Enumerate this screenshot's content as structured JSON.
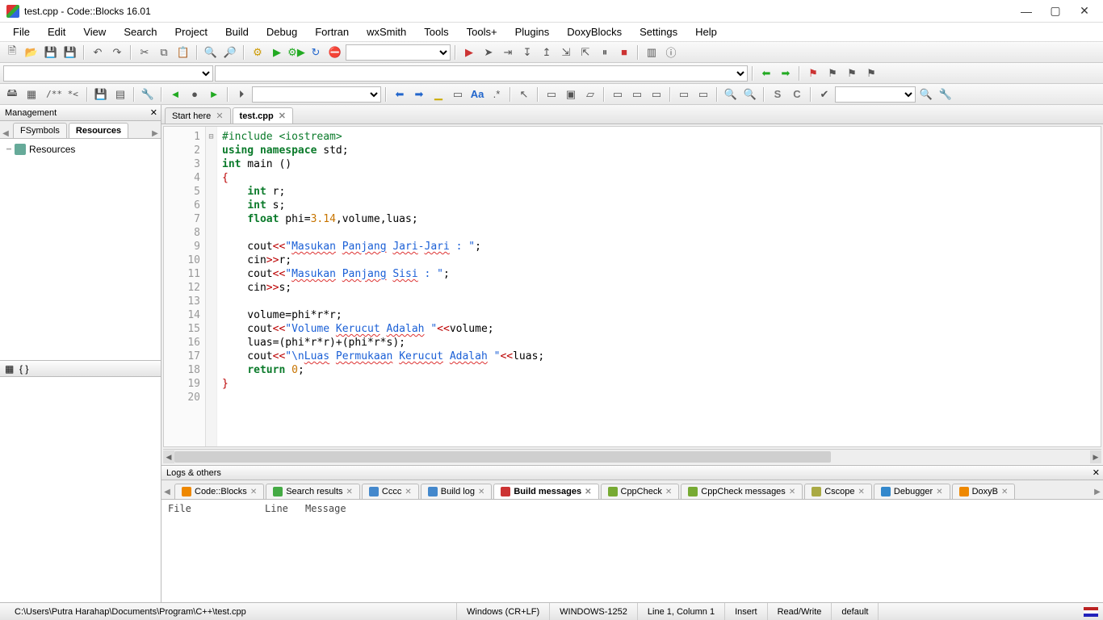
{
  "title": "test.cpp - Code::Blocks 16.01",
  "menu": [
    "File",
    "Edit",
    "View",
    "Search",
    "Project",
    "Build",
    "Debug",
    "Fortran",
    "wxSmith",
    "Tools",
    "Tools+",
    "Plugins",
    "DoxyBlocks",
    "Settings",
    "Help"
  ],
  "management": {
    "title": "Management",
    "tabs": [
      "FSymbols",
      "Resources"
    ],
    "active_tab": "Resources",
    "tree_root": "Resources",
    "lower_label": "{ }"
  },
  "editor_tabs": [
    {
      "label": "Start here",
      "active": false
    },
    {
      "label": "test.cpp",
      "active": true
    }
  ],
  "code_lines": [
    {
      "n": 1,
      "html": "<span class='pp'>#include &lt;iostream&gt;</span>"
    },
    {
      "n": 2,
      "html": "<span class='kw'>using</span> <span class='kw'>namespace</span> std;"
    },
    {
      "n": 3,
      "html": "<span class='kw'>int</span> main ()"
    },
    {
      "n": 4,
      "html": "<span class='brace'>{</span>",
      "fold": "⊟"
    },
    {
      "n": 5,
      "html": "    <span class='kw'>int</span> r;"
    },
    {
      "n": 6,
      "html": "    <span class='kw'>int</span> s;"
    },
    {
      "n": 7,
      "html": "    <span class='kw'>float</span> phi=<span class='num'>3.14</span>,volume,luas;"
    },
    {
      "n": 8,
      "html": ""
    },
    {
      "n": 9,
      "html": "    cout<span class='op'>&lt;&lt;</span><span class='str'>\"<span class='spell'>Masukan</span> <span class='spell'>Panjang</span> <span class='spell'>Jari</span>-<span class='spell'>Jari</span> : \"</span>;"
    },
    {
      "n": 10,
      "html": "    cin<span class='op'>&gt;&gt;</span>r;"
    },
    {
      "n": 11,
      "html": "    cout<span class='op'>&lt;&lt;</span><span class='str'>\"<span class='spell'>Masukan</span> <span class='spell'>Panjang</span> <span class='spell'>Sisi</span> : \"</span>;"
    },
    {
      "n": 12,
      "html": "    cin<span class='op'>&gt;&gt;</span>s;"
    },
    {
      "n": 13,
      "html": ""
    },
    {
      "n": 14,
      "html": "    volume=phi*r*r;"
    },
    {
      "n": 15,
      "html": "    cout<span class='op'>&lt;&lt;</span><span class='str'>\"Volume <span class='spell'>Kerucut</span> <span class='spell'>Adalah</span> \"</span><span class='op'>&lt;&lt;</span>volume;"
    },
    {
      "n": 16,
      "html": "    luas=(phi*r*r)+(phi*r*s);"
    },
    {
      "n": 17,
      "html": "    cout<span class='op'>&lt;&lt;</span><span class='str'>\"\\n<span class='spell'>Luas</span> <span class='spell'>Permukaan</span> <span class='spell'>Kerucut</span> <span class='spell'>Adalah</span> \"</span><span class='op'>&lt;&lt;</span>luas;"
    },
    {
      "n": 18,
      "html": "    <span class='kw'>return</span> <span class='num'>0</span>;"
    },
    {
      "n": 19,
      "html": "<span class='brace'>}</span>"
    },
    {
      "n": 20,
      "html": ""
    }
  ],
  "logs": {
    "title": "Logs & others",
    "tabs": [
      "Code::Blocks",
      "Search results",
      "Cccc",
      "Build log",
      "Build messages",
      "CppCheck",
      "CppCheck messages",
      "Cscope",
      "Debugger",
      "DoxyB"
    ],
    "active_tab": "Build messages",
    "columns": [
      "File",
      "Line",
      "Message"
    ]
  },
  "status": {
    "path": "C:\\Users\\Putra Harahap\\Documents\\Program\\C++\\test.cpp",
    "eol": "Windows (CR+LF)",
    "encoding": "WINDOWS-1252",
    "cursor": "Line 1, Column 1",
    "mode": "Insert",
    "rw": "Read/Write",
    "profile": "default"
  },
  "toolbar_row3": {
    "comment_label": "/** *<"
  }
}
